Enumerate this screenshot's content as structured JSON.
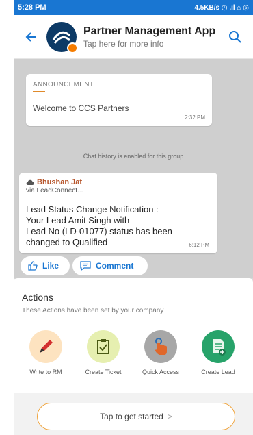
{
  "status_bar": {
    "time": "5:28 PM",
    "indicators": "4.5KB/s ◷ .ıl ⌂ ◎"
  },
  "header": {
    "title": "Partner Management App",
    "subtitle": "Tap here for more info",
    "back_icon": "arrow-left-icon",
    "search_icon": "search-icon"
  },
  "chat": {
    "announcement": {
      "label": "ANNOUNCEMENT",
      "text": "Welcome to CCS Partners",
      "time": "2:32 PM"
    },
    "history_note": "Chat history is enabled for this group",
    "lead_message": {
      "sender": "Bhushan Jat",
      "via": "via LeadConnect...",
      "body": "Lead Status Change Notification :\n Your Lead Amit Singh with\n Lead No (LD-01077) status has been\nchanged to Qualified",
      "time": "6:12 PM"
    },
    "like_label": "Like",
    "comment_label": "Comment"
  },
  "actions": {
    "title": "Actions",
    "subtitle": "These Actions have been set by your company",
    "items": [
      {
        "label": "Write to RM",
        "icon": "pen-icon",
        "color": "#fde3c0"
      },
      {
        "label": "Create Ticket",
        "icon": "clipboard-check-icon",
        "color": "#e6efb0"
      },
      {
        "label": "Quick Access",
        "icon": "touch-icon",
        "color": "#a7a7a7"
      },
      {
        "label": "Create Lead",
        "icon": "add-document-icon",
        "color": "#27a36a"
      }
    ],
    "start_label": "Tap to get started"
  }
}
